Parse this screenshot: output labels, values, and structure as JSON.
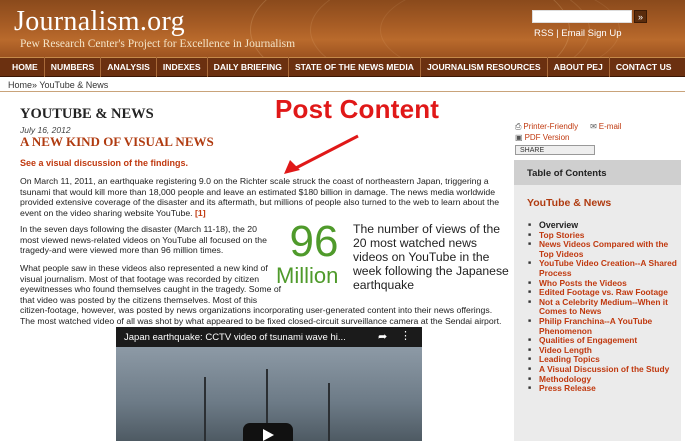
{
  "header": {
    "logo": "Journalism.org",
    "tagline": "Pew Research Center's Project for Excellence in Journalism",
    "search_button": "»",
    "rss_links": "RSS | Email Sign Up"
  },
  "nav": {
    "items": [
      "HOME",
      "NUMBERS",
      "ANALYSIS",
      "INDEXES",
      "DAILY BRIEFING",
      "STATE OF THE NEWS MEDIA",
      "JOURNALISM RESOURCES",
      "ABOUT PEJ",
      "CONTACT US"
    ]
  },
  "breadcrumb": {
    "home": "Home»",
    "current": "YouTube & News"
  },
  "annotation": {
    "text": "Post Content",
    "color": "#e01818"
  },
  "article": {
    "section_title": "YOUTUBE & NEWS",
    "date": "July 16, 2012",
    "title": "A NEW KIND OF VISUAL NEWS",
    "discussion_link": "See a visual discussion of the findings.",
    "para1": "On March 11, 2011, an earthquake registering 9.0 on the Richter scale struck the coast of northeastern Japan, triggering a tsunami that would kill more than 18,000 people and leave an estimated $180 billion in damage. The news media worldwide provided extensive coverage of the disaster and its aftermath, but millions of people also turned to the web to learn about the event on the video sharing website YouTube.",
    "para1_footnote": "[1]",
    "para2": "In the seven days following the disaster (March 11-18), the 20 most viewed news-related videos on YouTube all focused on the tragedy-and were viewed more than 96 million times.",
    "para3_narrow": "What people saw in these videos also represented a new kind of visual journalism. Most of that footage was recorded by citizen eyewitnesses who found themselves caught in the tragedy. Some of that video was posted by the citizens themselves. Most of this",
    "para3_rest": "citizen-footage, however, was posted by news organizations incorporating user-generated content into their news offerings. The most watched video of all was shot by what appeared to be fixed closed-circuit surveillance camera at the Sendai airport.",
    "highlight_number": "96",
    "highlight_unit": "Million",
    "highlight_text": "The number of views of the 20 most watched news videos on YouTube in the week following the Japanese earthquake",
    "highlight_color": "#4f9a2b"
  },
  "video": {
    "title": "Japan earthquake: CCTV video of tsunami wave hi...",
    "share_icon": "share-icon",
    "more_icon": "more-icon"
  },
  "share": {
    "printer": "Printer-Friendly",
    "email": "E-mail",
    "pdf": "PDF Version",
    "share_button": "SHARE"
  },
  "toc": {
    "header": "Table of Contents",
    "section": "YouTube & News",
    "items": [
      "Overview",
      "Top Stories",
      "News Videos Compared with the Top Videos",
      "YouTube Video Creation--A Shared Process",
      "Who Posts the Videos",
      "Edited Footage vs. Raw Footage",
      "Not a Celebrity Medium--When it Comes to News",
      "Philip Franchina--A YouTube Phenomenon",
      "Qualities of Engagement",
      "Video Length",
      "Leading Topics",
      "A Visual Discussion of the Study",
      "Methodology",
      "Press Release"
    ]
  }
}
